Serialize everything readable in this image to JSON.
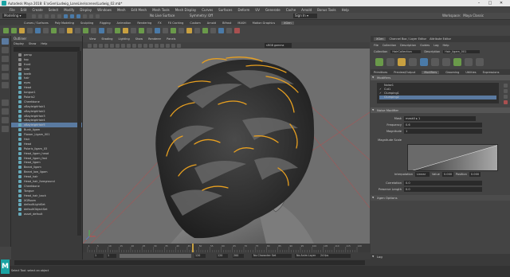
{
  "window": {
    "title": "Autodesk Maya 2018: E:\\xGen\\Ludwig_LoneLine\\scenes\\Ludwig_02.mb*",
    "controls": [
      "–",
      "□",
      "✕"
    ]
  },
  "menubar": [
    "File",
    "Edit",
    "Create",
    "Select",
    "Modify",
    "Display",
    "Windows",
    "Mesh",
    "Edit Mesh",
    "Mesh Tools",
    "Mesh Display",
    "Curves",
    "Surfaces",
    "Deform",
    "UV",
    "Generate",
    "Cache",
    "Arnold",
    "Bonus Tools",
    "Help"
  ],
  "status_line": {
    "mode": "Modeling",
    "live_surface": "No Live Surface",
    "symmetry": "Symmetry: Off",
    "sign_in": "Sign In",
    "workspace_label": "Workspace:",
    "workspace": "Maya Classic"
  },
  "shelf_tabs": [
    "Curves / Surfaces",
    "Poly Modeling",
    "Sculpting",
    "Rigging",
    "Animation",
    "Rendering",
    "FX",
    "FX Caching",
    "Custom",
    "Arnold",
    "Bifrost",
    "MASH",
    "Motion Graphics",
    "XGen"
  ],
  "outliner": {
    "title": "Outliner",
    "menus": [
      "Display",
      "Show",
      "Help"
    ],
    "items": [
      "persp",
      "top",
      "front",
      "side",
      "teeth",
      "hair",
      "eyes",
      "Head",
      "tongue1",
      "Polaris2",
      "Cheekbone",
      "xBayleighHair1",
      "xBayleighHair2",
      "xBayleighHair3",
      "xBayleighHair4",
      "xBayleighHair5",
      "Bunk_ligam",
      "Flower_Ligam_001",
      "Hair",
      "Head",
      "Polaris_ligam_03",
      "Head_ligam_head",
      "Head_ligam_fast",
      "Head_ligam",
      "Beard_ligam",
      "Beard_low_ligam",
      "Head_hair",
      "Head_hair_foreground",
      "Cheekbone",
      "Tongue",
      "Head_hair_back",
      "XGRoom",
      "defaultLightSet",
      "defaultObjectSet",
      "asset_default"
    ]
  },
  "viewport": {
    "menus": [
      "View",
      "Shading",
      "Lighting",
      "Show",
      "Renderer",
      "Panels"
    ],
    "camera_label": "persp",
    "colorspace": "sRGB gamma"
  },
  "time": {
    "ticks": [
      1,
      5,
      10,
      15,
      20,
      25,
      30,
      35,
      40,
      45,
      50,
      55,
      60,
      65,
      70,
      75,
      80,
      85,
      90,
      95,
      100,
      105,
      110,
      115,
      120
    ],
    "current_frame": "47",
    "range_start": "1",
    "range_inner_start": "1",
    "range_inner_end": "120",
    "range_end": "120",
    "playback_end": "200",
    "character_set": "No Character Set",
    "anim_layer": "No Anim Layer",
    "fps": "24 fps"
  },
  "mel": {
    "label": "MEL"
  },
  "help_line": "Select Tool: select an object",
  "right_panel": {
    "tabs": [
      "XGen",
      "Channel Box / Layer Editor",
      "Attribute Editor"
    ],
    "menus": [
      "File",
      "Collection",
      "Description",
      "Guides",
      "Log",
      "Help"
    ],
    "collection_label": "Collection",
    "collection": "HairCollection",
    "description_label": "Description",
    "description": "Hair_ligam_001",
    "sub_tabs": [
      "Primitives",
      "Preview/Output",
      "Modifiers",
      "Grooming",
      "Utilities",
      "Expressions"
    ],
    "modifiers_title": "Modifiers",
    "modifiers": [
      {
        "name": "Noise1",
        "checked": false
      },
      {
        "name": "Cut1",
        "checked": true
      },
      {
        "name": "Clumping1",
        "checked": true
      },
      {
        "name": "Clumping2",
        "checked": false
      }
    ],
    "noise_title": "Noise Modifier",
    "mask_label": "Mask",
    "mask_value": "mask0 ▸ 1",
    "frequency_label": "Frequency",
    "frequency": "0.6",
    "frequency_fill": 0.12,
    "magnitude_label": "Magnitude",
    "magnitude": "1",
    "magnitude_fill": 0.05,
    "magnitude_scale_label": "Magnitude Scale",
    "interpolation_label": "Interpolation",
    "interpolation": "Linear",
    "value_label": "Value",
    "value": "0.000",
    "position_label": "Position",
    "position": "0.000",
    "correlation_label": "Correlation",
    "correlation": "0.0",
    "preserve_length_label": "Preserve Length",
    "preserve_length": "0.0",
    "xgen_options_label": "Xgen Options",
    "log_label": "Log"
  }
}
